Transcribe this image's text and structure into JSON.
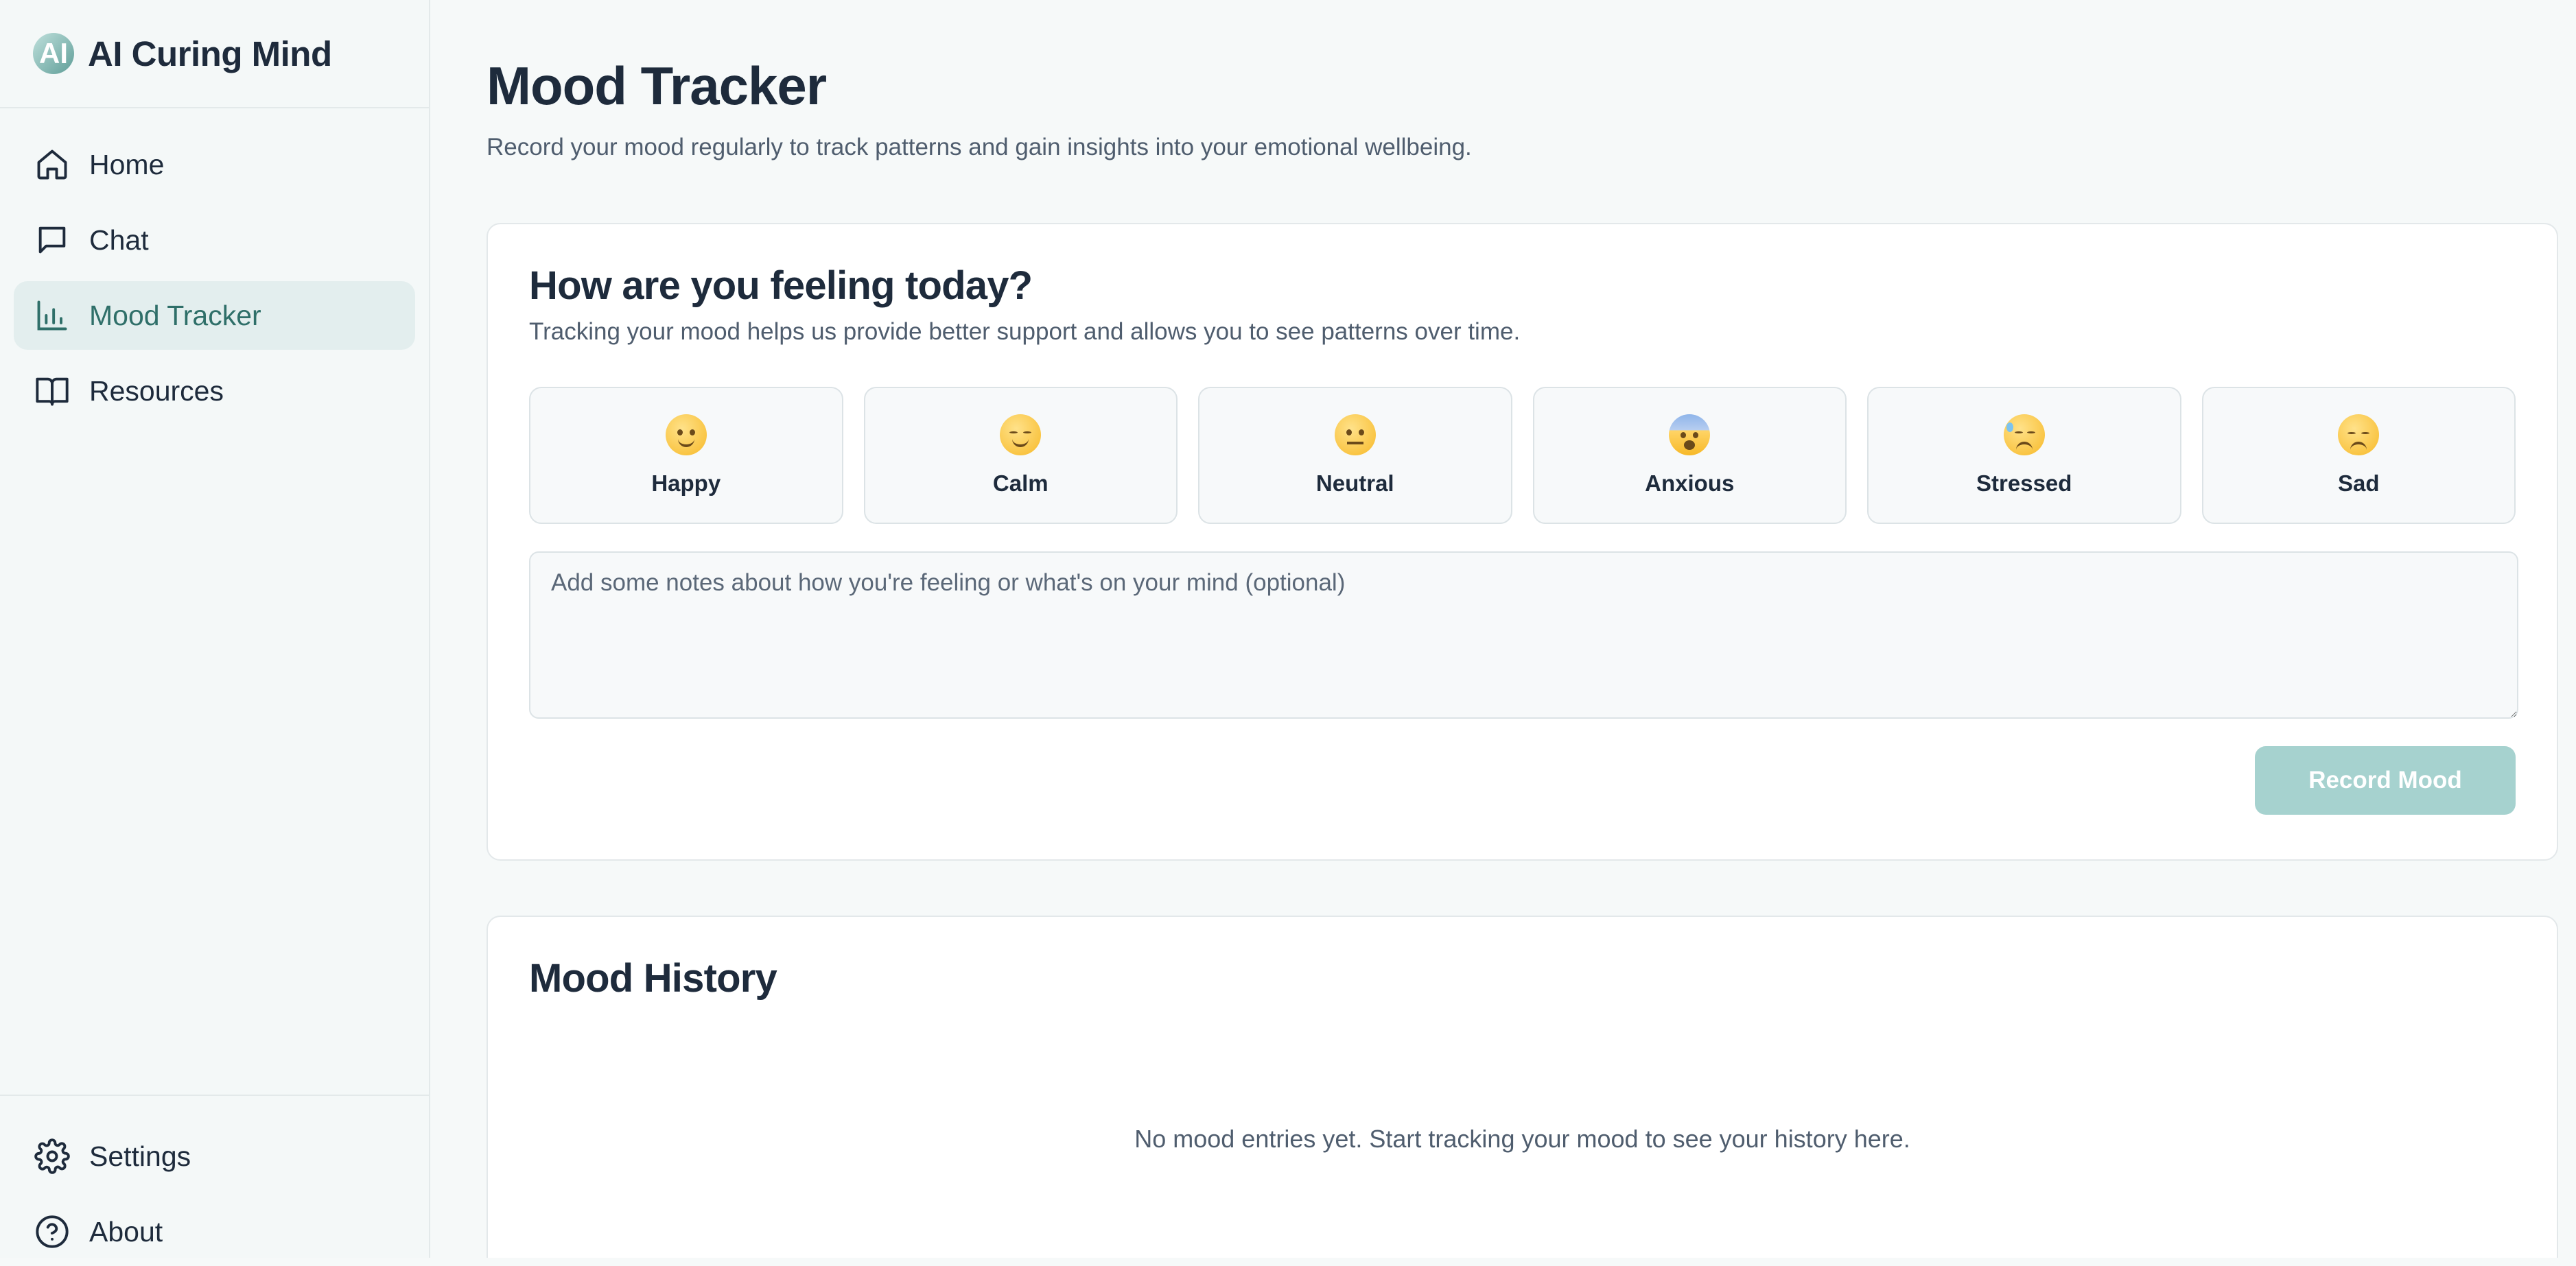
{
  "brand": {
    "logo_text": "AI",
    "name": "AI Curing Mind"
  },
  "sidebar": {
    "items": [
      {
        "label": "Home",
        "icon": "home-icon"
      },
      {
        "label": "Chat",
        "icon": "chat-icon"
      },
      {
        "label": "Mood Tracker",
        "icon": "bar-chart-icon",
        "active": true
      },
      {
        "label": "Resources",
        "icon": "book-icon"
      }
    ],
    "bottom_items": [
      {
        "label": "Settings",
        "icon": "gear-icon"
      },
      {
        "label": "About",
        "icon": "help-circle-icon"
      }
    ]
  },
  "page": {
    "title": "Mood Tracker",
    "subtitle": "Record your mood regularly to track patterns and gain insights into your emotional wellbeing."
  },
  "mood_card": {
    "title": "How are you feeling today?",
    "subtitle": "Tracking your mood helps us provide better support and allows you to see patterns over time.",
    "moods": [
      {
        "label": "Happy",
        "icon": "smiling-face-emoji"
      },
      {
        "label": "Calm",
        "icon": "relieved-face-emoji"
      },
      {
        "label": "Neutral",
        "icon": "neutral-face-emoji"
      },
      {
        "label": "Anxious",
        "icon": "anxious-face-emoji"
      },
      {
        "label": "Stressed",
        "icon": "downcast-sweat-face-emoji"
      },
      {
        "label": "Sad",
        "icon": "pensive-face-emoji"
      }
    ],
    "notes_placeholder": "Add some notes about how you're feeling or what's on your mind (optional)",
    "notes_value": "",
    "record_button": "Record Mood"
  },
  "history_card": {
    "title": "Mood History",
    "empty_text": "No mood entries yet. Start tracking your mood to see your history here."
  },
  "colors": {
    "accent": "#2f6f69",
    "active_bg": "#e3eeee",
    "button_disabled": "#a6d2cf",
    "page_bg": "#f6f9f9"
  }
}
